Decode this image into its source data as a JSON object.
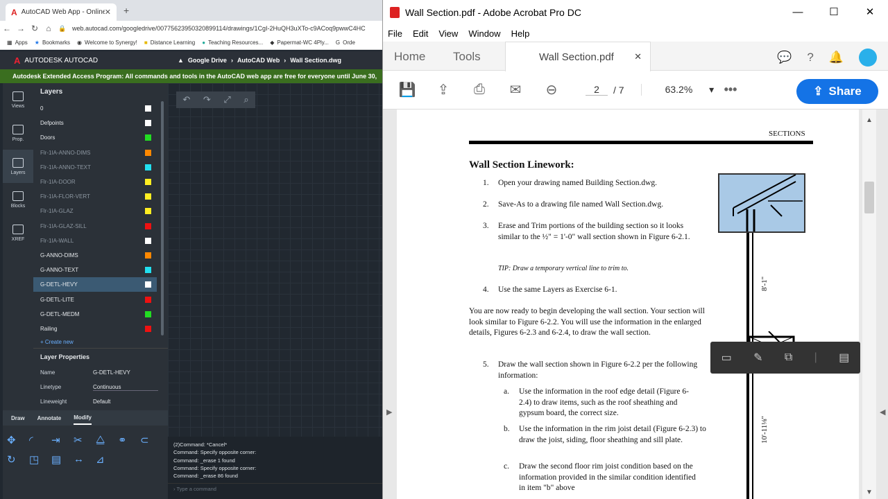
{
  "browser": {
    "tab_title": "AutoCAD Web App - Online CAD",
    "url": "web.autocad.com/googledrive/007756239503208991​14/drawings/1CgI-2HuQH3uXTo-c9ACoq9pwwC4HC",
    "bookmarks": [
      "Apps",
      "Bookmarks",
      "Welcome to Synergy!",
      "Distance Learning",
      "Teaching Resources...",
      "Papermat-WC 4Ply...",
      "Orde"
    ]
  },
  "autocad": {
    "brand": "AUTODESK AUTOCAD",
    "breadcrumb": [
      "Google Drive",
      "AutoCAD Web",
      "Wall Section.dwg"
    ],
    "banner": "Autodesk Extended Access Program: All commands and tools in the AutoCAD web app are free for everyone until June 30,",
    "rail": [
      "Views",
      "Prop.",
      "Layers",
      "Blocks",
      "XREF"
    ],
    "layers_title": "Layers",
    "layers": [
      {
        "name": "0",
        "color": "#ffffff",
        "dim": false
      },
      {
        "name": "Defpoints",
        "color": "#ffffff",
        "dim": false
      },
      {
        "name": "Doors",
        "color": "#22dd22",
        "dim": false
      },
      {
        "name": "Flr-1IA-ANNO-DIMS",
        "color": "#ff8800",
        "dim": true
      },
      {
        "name": "Flr-1IA-ANNO-TEXT",
        "color": "#22e0f0",
        "dim": true
      },
      {
        "name": "Flr-1IA-DOOR",
        "color": "#ffee22",
        "dim": true
      },
      {
        "name": "Flr-1IA-FLOR-VERT",
        "color": "#ffee22",
        "dim": true
      },
      {
        "name": "Flr-1IA-GLAZ",
        "color": "#ffee22",
        "dim": true
      },
      {
        "name": "Flr-1IA-GLAZ-SILL",
        "color": "#ee1111",
        "dim": true
      },
      {
        "name": "Flr-1IA-WALL",
        "color": "#ffffff",
        "dim": true
      },
      {
        "name": "G-ANNO-DIMS",
        "color": "#ff8800",
        "dim": false
      },
      {
        "name": "G-ANNO-TEXT",
        "color": "#22e0f0",
        "dim": false
      },
      {
        "name": "G-DETL-HEVY",
        "color": "#ffffff",
        "dim": false,
        "selected": true
      },
      {
        "name": "G-DETL-LITE",
        "color": "#ee1111",
        "dim": false
      },
      {
        "name": "G-DETL-MEDM",
        "color": "#22dd22",
        "dim": false
      },
      {
        "name": "Railing",
        "color": "#ee1111",
        "dim": false
      }
    ],
    "create_new": "+ Create new",
    "props_title": "Layer Properties",
    "props": [
      {
        "k": "Name",
        "v": "G-DETL-HEVY"
      },
      {
        "k": "Linetype",
        "v": "Continuous"
      },
      {
        "k": "Lineweight",
        "v": "Default"
      }
    ],
    "tool_tabs": [
      "Draw",
      "Annotate",
      "Modify"
    ],
    "commands": [
      "(2)Command: *Cancel*",
      "Command: Specify opposite corner:",
      "Command: _erase 1 found",
      "Command: Specify opposite corner:",
      "Command: _erase 86 found"
    ],
    "command_placeholder": "Type a command"
  },
  "acrobat": {
    "title": "Wall Section.pdf - Adobe Acrobat Pro DC",
    "menu": [
      "File",
      "Edit",
      "View",
      "Window",
      "Help"
    ],
    "tab_home": "Home",
    "tab_tools": "Tools",
    "doc_tab": "Wall Section.pdf",
    "page_current": "2",
    "page_total": "/ 7",
    "zoom": "63.2%",
    "share": "Share"
  },
  "pdf": {
    "header": "SECTIONS",
    "title": "Wall Section Linework:",
    "items": [
      {
        "n": "1.",
        "t": "Open your drawing named Building Section.dwg."
      },
      {
        "n": "2.",
        "t": "Save-As to a drawing file named Wall Section.dwg."
      },
      {
        "n": "3.",
        "t": "Erase and Trim portions of the building section so it looks similar to the ½\" = 1'-0\" wall section shown in Figure 6-2.1."
      },
      {
        "n": "",
        "t": "TIP: Draw a temporary vertical line to trim to."
      },
      {
        "n": "4.",
        "t": "Use the same Layers as Exercise 6-1."
      }
    ],
    "para": "You are now ready to begin developing the wall section. Your section will look similar to Figure 6-2.2. You will use the information in the enlarged details, Figures 6-2.3 and 6-2.4, to draw the wall section.",
    "item5": "Draw the wall section shown in Figure 6-2.2 per the following information:",
    "subs": [
      {
        "n": "a.",
        "t": "Use the information in the roof edge detail (Figure 6-2.4) to draw items, such as the roof sheathing and gypsum board, the correct size."
      },
      {
        "n": "b.",
        "t": "Use the information in the rim joist detail (Figure 6-2.3) to draw the joist, siding, floor sheathing and sill plate."
      },
      {
        "n": "c.",
        "t": "Draw the second floor rim joist condition based on the information provided in the similar condition identified in item \"b\" above"
      }
    ],
    "dim1": "8'-1\"",
    "dim2": "10'-11⅛\""
  }
}
